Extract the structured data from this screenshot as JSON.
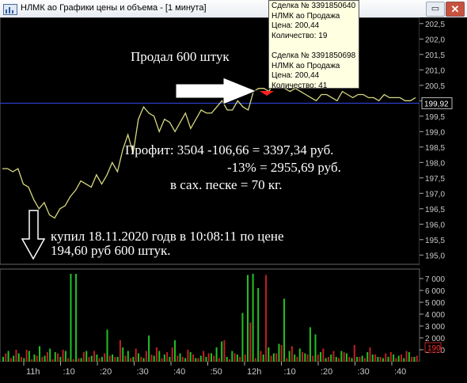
{
  "window": {
    "title": "НЛМК ао Графики цены и объема - [1 минута]",
    "restore_glyph": "▭",
    "close_glyph": "✕"
  },
  "tooltip": {
    "trade1": {
      "deal": "Сделка № 3391850640",
      "asset": "НЛМК ао Продажа",
      "price": "Цена: 200,44",
      "qty": "Количество: 19"
    },
    "trade2": {
      "deal": "Сделка № 3391850698",
      "asset": "НЛМК ао Продажа",
      "price": "Цена: 200,44",
      "qty": "Количество: 41"
    }
  },
  "annotations": {
    "sold": "Продал 600 штук",
    "profit_line1": "Профит:  3504 -106,66 = 3397,34 руб.",
    "profit_line2": "-13%     = 2955,69 руб.",
    "profit_line3": "в сах. песке          = 70 кг.",
    "bought_line1": "купил 18.11.2020 годв в 10:08:11 по цене",
    "bought_line2": "194,60 руб   600 штук."
  },
  "colors": {
    "background": "#000000",
    "price_line": "#d8d880",
    "current_price_line": "#3040d0",
    "volume_up": "#22c222",
    "volume_down": "#c02020",
    "trade_marker": "#ff2020",
    "axis_text": "#c8c8c8"
  },
  "chart_data": [
    {
      "type": "line",
      "series": [
        {
          "values": [
            197.8,
            197.8,
            197.7,
            197.8,
            197.3,
            197.2,
            196.8,
            196.5,
            196.7,
            196.3,
            196.2,
            196.5,
            196.6,
            196.9,
            197.1,
            197.4,
            197.3,
            197.2,
            197.6,
            197.3,
            197.6,
            198.0,
            197.7,
            198.4,
            198.9,
            198.3,
            199.4,
            199.8,
            199.6,
            199.5,
            199.0,
            199.4,
            199.3,
            199.0,
            199.3,
            199.6,
            199.1,
            199.4,
            199.7,
            199.6,
            199.6,
            199.8,
            200.0,
            199.7,
            199.7,
            200.0,
            199.8,
            199.7,
            200.3,
            200.4,
            200.4,
            200.3,
            200.7,
            200.5,
            200.4,
            200.3,
            200.4,
            200.3,
            200.2,
            200.1,
            200.0,
            200.2,
            200.2,
            200.1,
            200.0,
            200.3,
            200.2,
            200.1,
            200.2,
            200.2,
            200.1,
            200.1,
            200.0,
            200.2,
            200.1,
            200.1,
            200.1,
            200.0,
            200.0,
            200.1
          ]
        }
      ],
      "current_price": {
        "value": 199.92,
        "label": "199,92"
      },
      "y_ticks": [
        "202,5",
        "202,0",
        "201,5",
        "201,0",
        "200,5",
        "200,0",
        "199,5",
        "199,0",
        "198,5",
        "198,0",
        "197,5",
        "197,0",
        "196,5",
        "196,0",
        "195,5",
        "195,0"
      ],
      "ylim": [
        194.7,
        202.7
      ]
    },
    {
      "type": "bar",
      "series": [
        {
          "name": "up",
          "values": [
            400,
            900,
            500,
            700,
            300,
            900,
            600,
            1300,
            500,
            1100,
            800,
            400,
            900,
            7400,
            7400,
            300,
            900,
            500,
            600,
            400,
            2700,
            600,
            400,
            1200,
            900,
            400,
            700,
            300,
            2200,
            500,
            900,
            600,
            400,
            1800,
            700,
            300,
            800,
            300,
            500,
            400,
            700,
            1200,
            1700,
            400,
            900,
            600,
            4100,
            7300,
            7400,
            6200,
            600,
            1200,
            700,
            1500,
            5300,
            900,
            600,
            1100,
            700,
            2900,
            2300,
            800,
            300,
            600,
            400,
            900,
            700,
            300,
            400,
            500,
            800,
            600,
            400,
            300,
            400,
            600,
            500,
            300,
            800,
            400
          ]
        },
        {
          "name": "down",
          "values": [
            700,
            300,
            1000,
            400,
            1000,
            200,
            500,
            400,
            800,
            200,
            700,
            1000,
            300,
            200,
            300,
            800,
            400,
            900,
            300,
            700,
            500,
            400,
            1800,
            500,
            300,
            1100,
            400,
            900,
            600,
            1200,
            300,
            800,
            1200,
            500,
            400,
            1000,
            600,
            300,
            900,
            700,
            500,
            300,
            1800,
            200,
            700,
            400,
            600,
            3300,
            300,
            900,
            7300,
            500,
            700,
            1400,
            300,
            1300,
            400,
            800,
            600,
            500,
            600,
            1100,
            400,
            900,
            300,
            800,
            400,
            1400,
            400,
            300,
            1200,
            600,
            400,
            700,
            800,
            300,
            600,
            900,
            400,
            500
          ]
        }
      ],
      "last_volume_label": "190",
      "y_ticks": [
        "7 000",
        "6 000",
        "5 000",
        "4 000",
        "3 000",
        "2 000",
        "1 000"
      ],
      "ylim": [
        0,
        7800
      ],
      "x_ticks": [
        "11h",
        ":10",
        ":20",
        ":30",
        ":40",
        ":50",
        "12h",
        ":10",
        ":20",
        ":30",
        ":40"
      ]
    }
  ]
}
